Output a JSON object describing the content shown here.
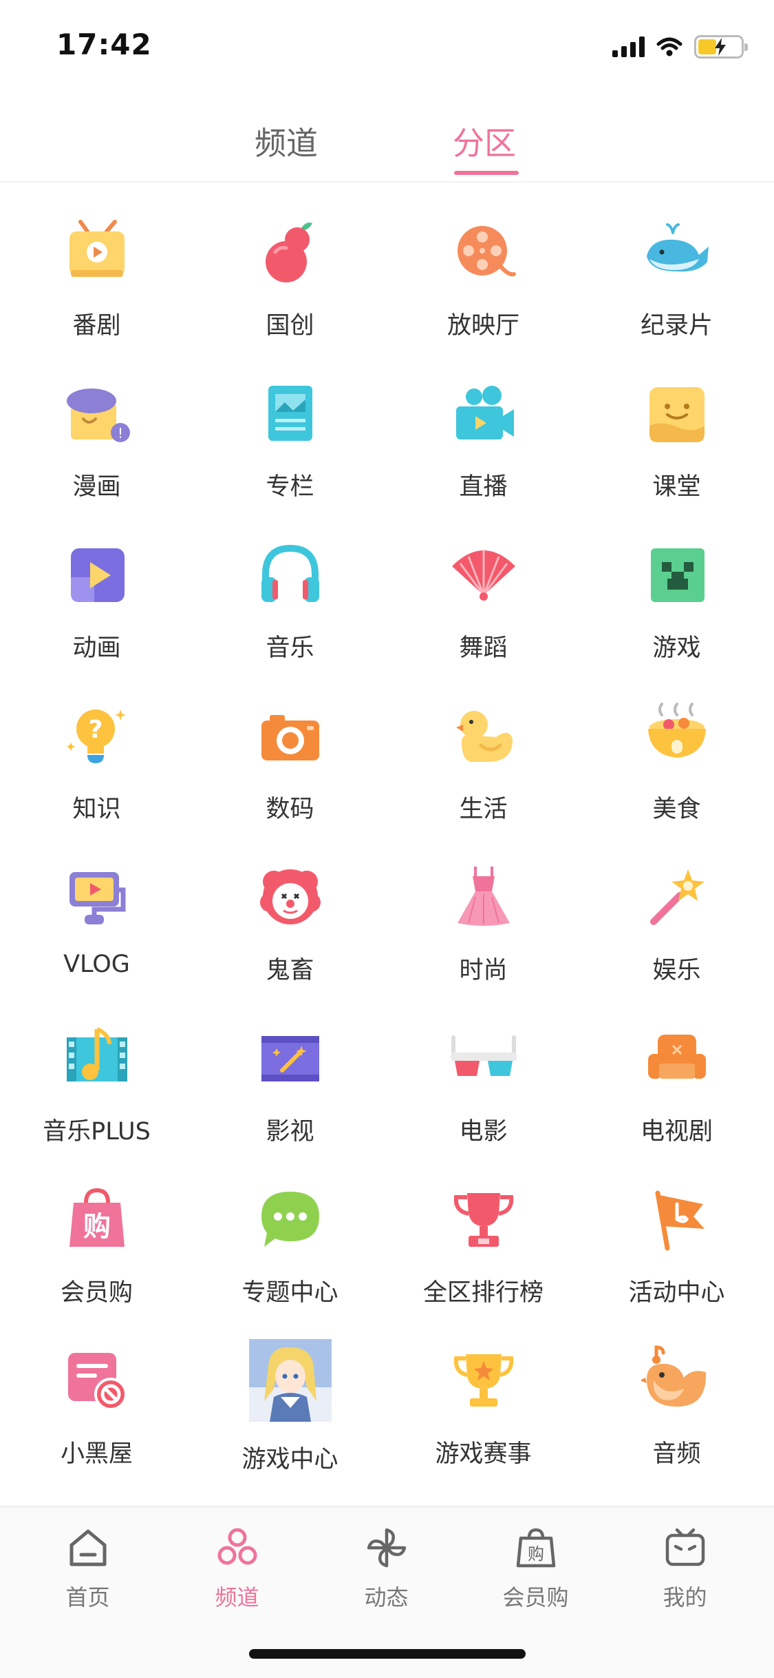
{
  "status_bar": {
    "time": "17:42"
  },
  "top_tabs": [
    {
      "label": "频道",
      "active": false
    },
    {
      "label": "分区",
      "active": true
    }
  ],
  "colors": {
    "accent": "#f0739a",
    "text": "#333333",
    "inactive": "#777777"
  },
  "categories": [
    {
      "label": "番剧",
      "icon": "tv-icon"
    },
    {
      "label": "国创",
      "icon": "gourd-icon"
    },
    {
      "label": "放映厅",
      "icon": "film-reel-icon"
    },
    {
      "label": "纪录片",
      "icon": "whale-icon"
    },
    {
      "label": "漫画",
      "icon": "comic-icon"
    },
    {
      "label": "专栏",
      "icon": "article-icon"
    },
    {
      "label": "直播",
      "icon": "camera-live-icon"
    },
    {
      "label": "课堂",
      "icon": "class-icon"
    },
    {
      "label": "动画",
      "icon": "animation-icon"
    },
    {
      "label": "音乐",
      "icon": "headphones-icon"
    },
    {
      "label": "舞蹈",
      "icon": "fan-icon"
    },
    {
      "label": "游戏",
      "icon": "creeper-icon"
    },
    {
      "label": "知识",
      "icon": "lightbulb-icon"
    },
    {
      "label": "数码",
      "icon": "photo-camera-icon"
    },
    {
      "label": "生活",
      "icon": "duck-icon"
    },
    {
      "label": "美食",
      "icon": "bowl-icon"
    },
    {
      "label": "VLOG",
      "icon": "vlog-icon"
    },
    {
      "label": "鬼畜",
      "icon": "clown-icon"
    },
    {
      "label": "时尚",
      "icon": "dress-icon"
    },
    {
      "label": "娱乐",
      "icon": "magic-wand-icon"
    },
    {
      "label": "音乐PLUS",
      "icon": "music-film-icon"
    },
    {
      "label": "影视",
      "icon": "movie-strip-icon"
    },
    {
      "label": "电影",
      "icon": "3d-glasses-icon"
    },
    {
      "label": "电视剧",
      "icon": "sofa-icon"
    },
    {
      "label": "会员购",
      "icon": "shopping-bag-icon"
    },
    {
      "label": "专题中心",
      "icon": "chat-bubble-icon"
    },
    {
      "label": "全区排行榜",
      "icon": "trophy-icon"
    },
    {
      "label": "活动中心",
      "icon": "flag-icon"
    },
    {
      "label": "小黑屋",
      "icon": "blocked-icon"
    },
    {
      "label": "游戏中心",
      "icon": "anime-avatar-icon"
    },
    {
      "label": "游戏赛事",
      "icon": "star-trophy-icon"
    },
    {
      "label": "音频",
      "icon": "bird-icon"
    }
  ],
  "bottom_nav": [
    {
      "label": "首页",
      "icon": "home-icon",
      "active": false
    },
    {
      "label": "频道",
      "icon": "channel-icon",
      "active": true
    },
    {
      "label": "动态",
      "icon": "pinwheel-icon",
      "active": false
    },
    {
      "label": "会员购",
      "icon": "shop-bag-icon",
      "active": false
    },
    {
      "label": "我的",
      "icon": "tv-face-icon",
      "active": false
    }
  ]
}
